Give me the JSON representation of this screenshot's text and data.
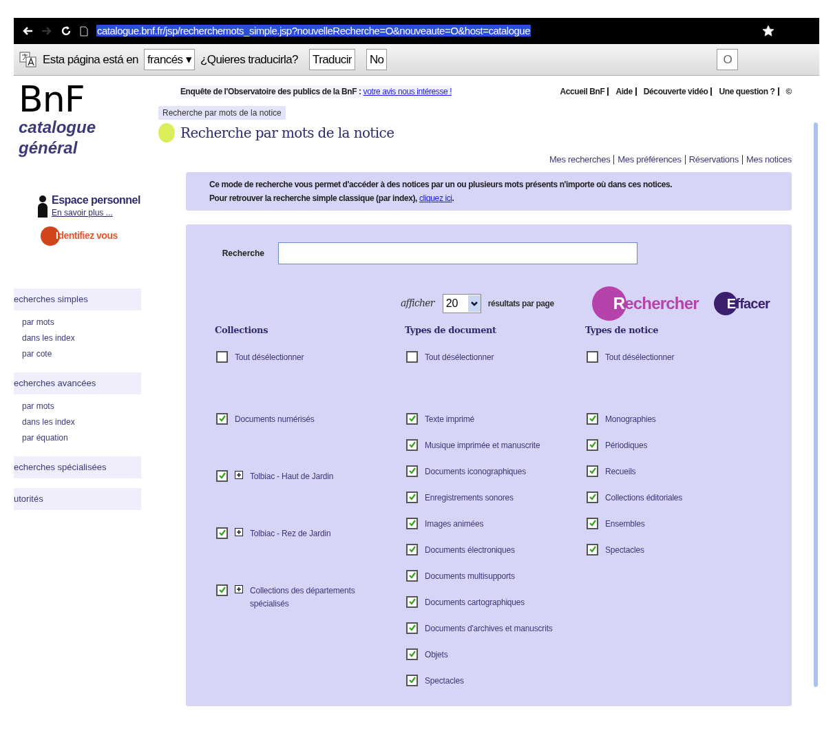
{
  "browser": {
    "url": "catalogue.bnf.fr/jsp/recherchemots_simple.jsp?nouvelleRecherche=O&nouveaute=O&host=catalogue"
  },
  "translate_bar": {
    "prefix": "Esta página está en",
    "language": "francés ▾",
    "question": "¿Quieres traducirla?",
    "buttons": [
      "Traducir",
      "No"
    ],
    "options": "O"
  },
  "logo": {
    "mark": "BnF",
    "line1": "catalogue",
    "line2": "général"
  },
  "top_notice": {
    "text": "Enquête de l'Observatoire des publics de la BnF :",
    "link": "votre avis nous intéresse !"
  },
  "top_links": [
    "Accueil BnF",
    "Aide",
    "Découverte vidéo",
    "Une question ?",
    "©"
  ],
  "breadcrumb": "Recherche par mots de la notice",
  "page_title": "Recherche par mots de la notice",
  "user_links": [
    "Mes recherches",
    "Mes préférences",
    "Réservations",
    "Mes notices"
  ],
  "info": {
    "line1": "Ce mode de recherche vous permet d'accéder à des notices par un ou plusieurs mots présents n'importe où dans ces notices.",
    "line2": "Pour retrouver la recherche simple classique (par index),",
    "link": "cliquez ici",
    "end": "."
  },
  "sidebar": {
    "personal": {
      "title": "Espace personnel",
      "link": "En savoir plus ..."
    },
    "login": "Identifiez vous",
    "sections": [
      {
        "title": "echerches simples",
        "items": [
          "par mots",
          "dans les index",
          "par cote"
        ]
      },
      {
        "title": "echerches avancées",
        "items": [
          "par mots",
          "dans les index",
          "par équation"
        ]
      },
      {
        "title": "echerches spécialisées"
      },
      {
        "title": "utorités"
      }
    ]
  },
  "search": {
    "label": "Recherche"
  },
  "results": {
    "prefix": "afficher",
    "value": "20",
    "suffix": "résultats par page"
  },
  "actions": [
    "Rechercher",
    "Effacer"
  ],
  "columns": [
    {
      "title": "Collections",
      "deselect": {
        "label": "Tout désélectionner",
        "checked": false
      },
      "items": [
        {
          "label": "Documents numérisés",
          "checked": true,
          "kind": "plain"
        },
        {
          "label": "Tolbiac - Haut de Jardin",
          "checked": true,
          "kind": "expandable"
        },
        {
          "label": "Tolbiac - Rez de Jardin",
          "checked": true,
          "kind": "expandable"
        },
        {
          "label": "Collections des départements spécialisés",
          "checked": true,
          "kind": "expandable"
        }
      ]
    },
    {
      "title": "Types de document",
      "deselect": {
        "label": "Tout désélectionner",
        "checked": false
      },
      "items": [
        {
          "label": "Texte imprimé",
          "checked": true,
          "kind": "plain"
        },
        {
          "label": "Musique imprimée et manuscrite",
          "checked": true,
          "kind": "plain"
        },
        {
          "label": "Documents iconographiques",
          "checked": true,
          "kind": "plain"
        },
        {
          "label": "Enregistrements sonores",
          "checked": true,
          "kind": "plain"
        },
        {
          "label": "Images animées",
          "checked": true,
          "kind": "plain"
        },
        {
          "label": "Documents électroniques",
          "checked": true,
          "kind": "plain"
        },
        {
          "label": "Documents multisupports",
          "checked": true,
          "kind": "plain"
        },
        {
          "label": "Documents cartographiques",
          "checked": true,
          "kind": "plain"
        },
        {
          "label": "Documents d'archives et manuscrits",
          "checked": true,
          "kind": "plain"
        },
        {
          "label": "Objets",
          "checked": true,
          "kind": "plain"
        },
        {
          "label": "Spectacles",
          "checked": true,
          "kind": "plain"
        }
      ]
    },
    {
      "title": "Types de notice",
      "deselect": {
        "label": "Tout désélectionner",
        "checked": false
      },
      "items": [
        {
          "label": "Monographies",
          "checked": true,
          "kind": "plain"
        },
        {
          "label": "Périodiques",
          "checked": true,
          "kind": "plain"
        },
        {
          "label": "Recueils",
          "checked": true,
          "kind": "plain"
        },
        {
          "label": "Collections éditoriales",
          "checked": true,
          "kind": "plain"
        },
        {
          "label": "Ensembles",
          "checked": true,
          "kind": "plain"
        },
        {
          "label": "Spectacles",
          "checked": true,
          "kind": "plain"
        }
      ]
    }
  ]
}
